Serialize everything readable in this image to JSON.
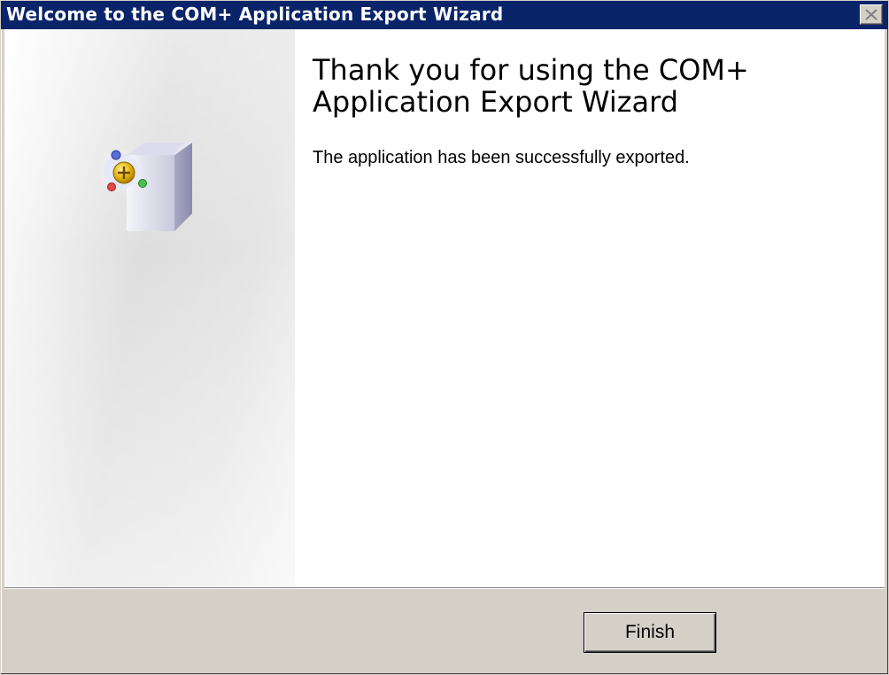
{
  "window": {
    "title": "Welcome to the COM+ Application Export Wizard",
    "close_icon": "close-icon",
    "titlebar_color": "#0a246a"
  },
  "main": {
    "heading": "Thank you for using the COM+ Application Export Wizard",
    "message": "The application has been successfully exported.",
    "graphic_icon": "com-package-icon"
  },
  "footer": {
    "finish_label": "Finish"
  }
}
